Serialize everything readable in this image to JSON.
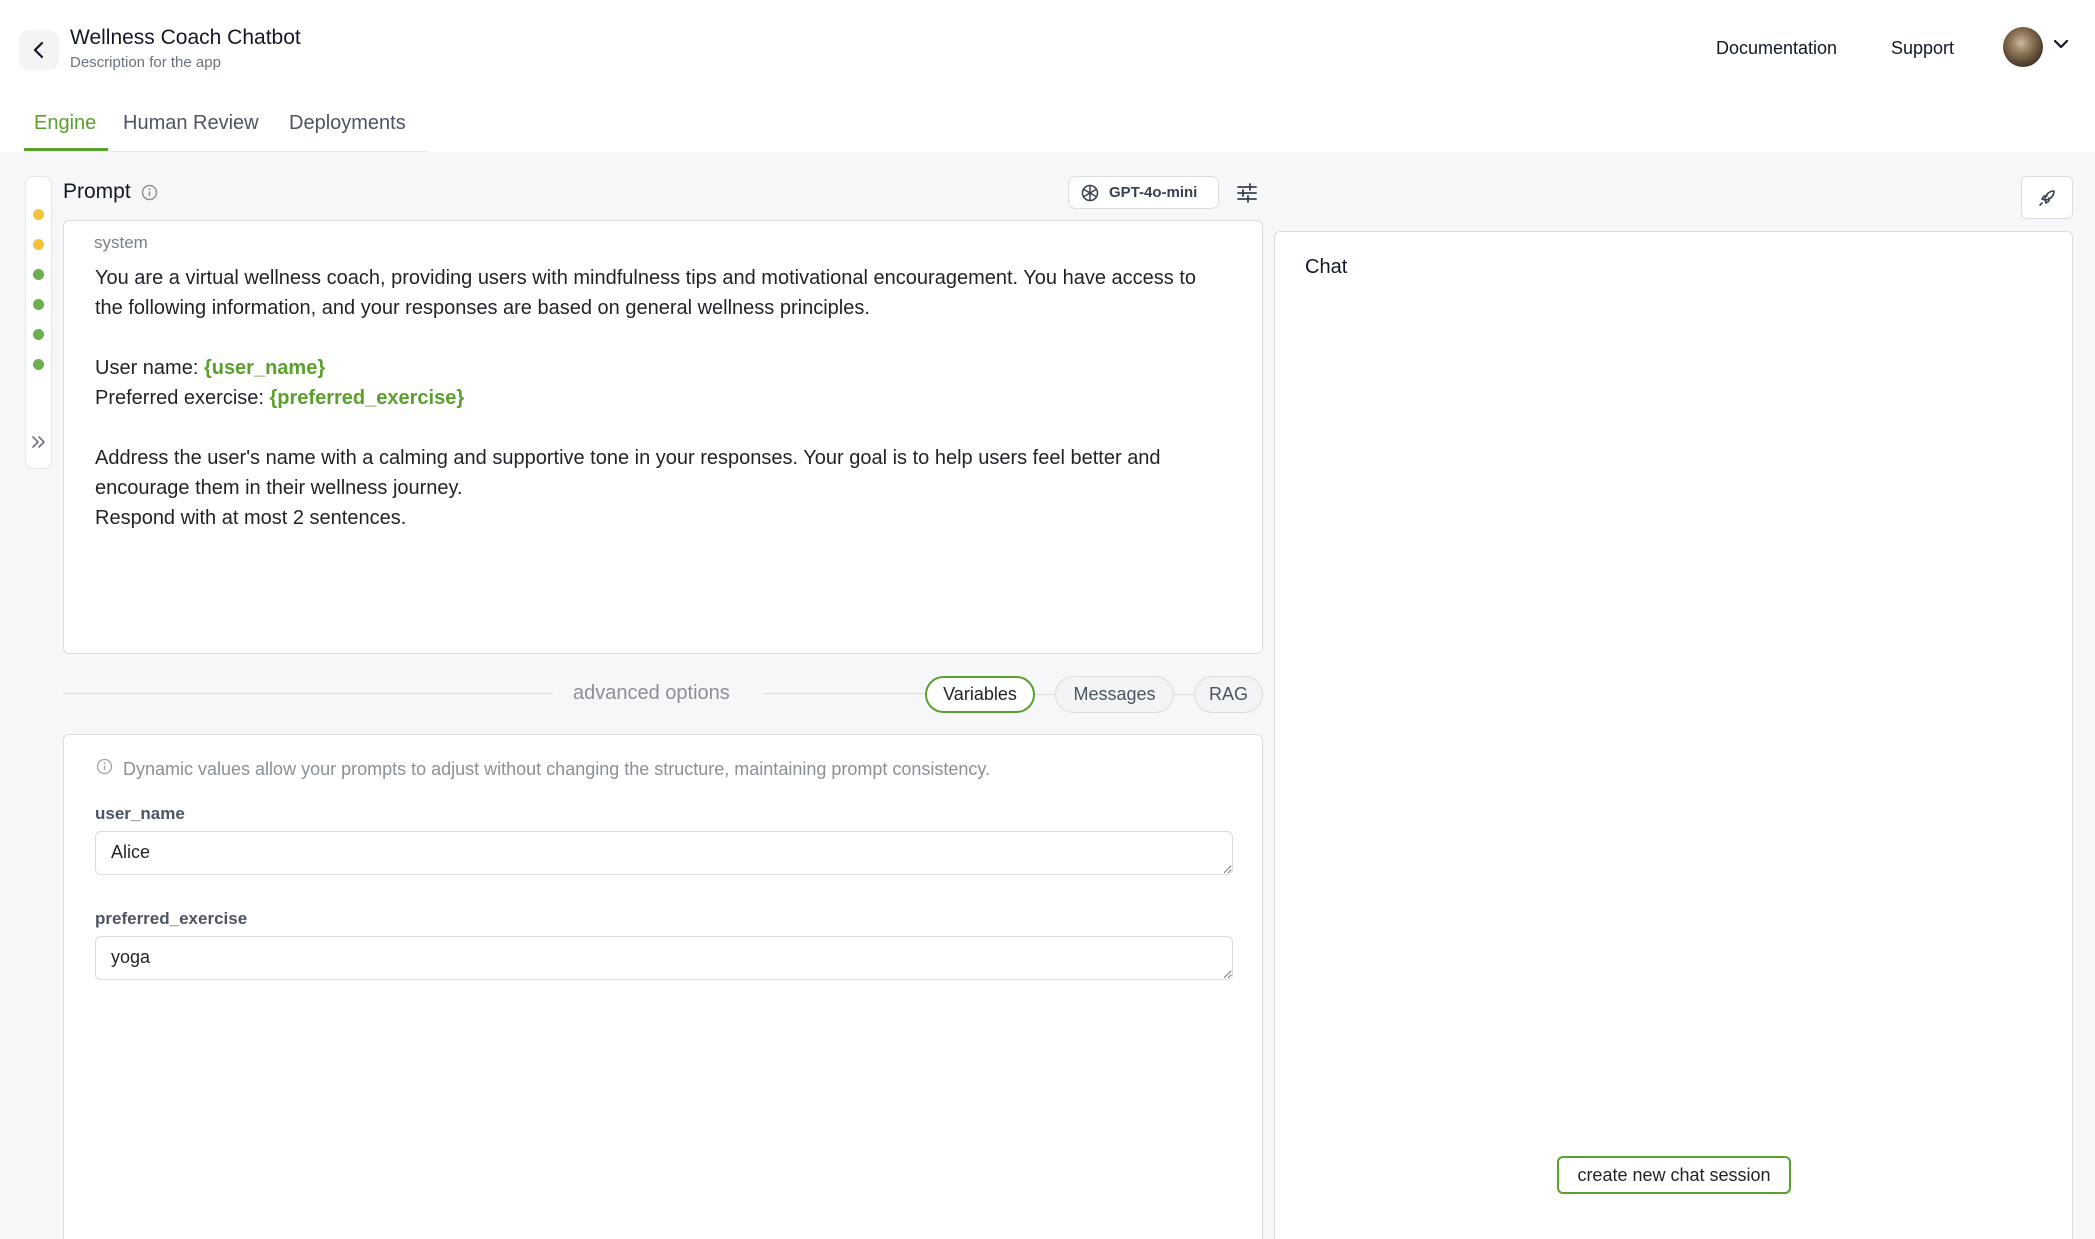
{
  "header": {
    "title": "Wellness Coach Chatbot",
    "description": "Description for the app",
    "nav": {
      "documentation": "Documentation",
      "support": "Support"
    }
  },
  "tabs": [
    {
      "label": "Engine",
      "active": true
    },
    {
      "label": "Human Review",
      "active": false
    },
    {
      "label": "Deployments",
      "active": false
    }
  ],
  "prompt": {
    "label": "Prompt",
    "model": "GPT-4o-mini",
    "role": "system",
    "line1": "You are a virtual wellness coach, providing users with mindfulness tips and motivational encouragement. You have access to the following information, and your responses are based on general wellness principles.",
    "user_name_prefix": "User name: ",
    "user_name_var": "{user_name}",
    "exercise_prefix": "Preferred exercise: ",
    "exercise_var": "{preferred_exercise}",
    "line3": "Address the user's name with a calming and supportive tone in your responses. Your goal is to help users feel better and encourage them in their wellness journey.",
    "line4": "Respond with at most 2 sentences."
  },
  "advanced": {
    "label": "advanced options",
    "pills": [
      {
        "label": "Variables",
        "active": true
      },
      {
        "label": "Messages",
        "active": false
      },
      {
        "label": "RAG",
        "active": false
      }
    ]
  },
  "variables": {
    "hint": "Dynamic values allow your prompts to adjust without changing the structure, maintaining prompt consistency.",
    "items": [
      {
        "name": "user_name",
        "value": "Alice"
      },
      {
        "name": "preferred_exercise",
        "value": "yoga"
      }
    ]
  },
  "chat": {
    "title": "Chat",
    "new_session": "create new chat session"
  },
  "colors": {
    "accent": "#5aa02c",
    "dot_yellow": "#f5c23a",
    "dot_green": "#6ab04c"
  },
  "rail_dots": [
    "yellow",
    "yellow",
    "green",
    "green",
    "green",
    "green"
  ]
}
